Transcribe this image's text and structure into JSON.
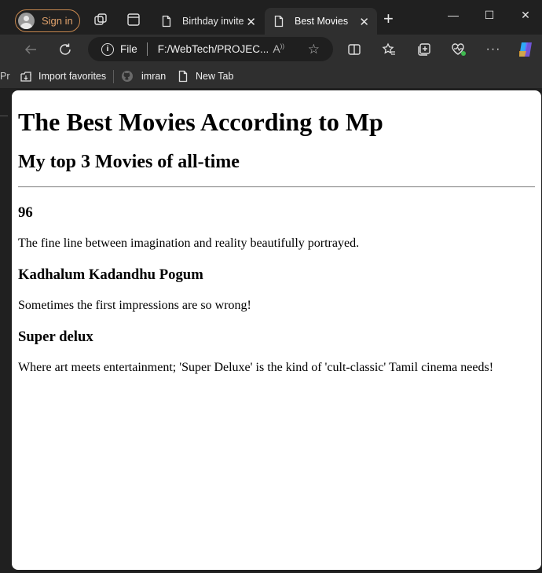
{
  "browser": {
    "signin_label": "Sign in",
    "tabs": [
      {
        "title": "Birthday invite",
        "active": false
      },
      {
        "title": "Best Movies",
        "active": true
      }
    ],
    "new_tab_symbol": "+",
    "window_controls": {
      "minimize": "—",
      "maximize": "☐",
      "close": "✕"
    },
    "address": {
      "scheme": "File",
      "url": "F:/WebTech/PROJEC..."
    },
    "favorites": [
      {
        "label": "Import favorites",
        "icon": "import-favorites-icon"
      },
      {
        "label": "imran",
        "icon": "github-icon"
      },
      {
        "label": "New Tab",
        "icon": "document-icon"
      }
    ],
    "clipped_side_text": "Pr",
    "accent_color": "#c8884f",
    "copilot_colors": [
      "#2ea9f5",
      "#7b5cf5",
      "#f5a623"
    ]
  },
  "page": {
    "heading": "The Best Movies According to Mp",
    "subheading": "My top 3 Movies of all-time",
    "movies": [
      {
        "title": "96",
        "description": "The fine line between imagination and reality beautifully portrayed."
      },
      {
        "title": "Kadhalum Kadandhu Pogum",
        "description": "Sometimes the first impressions are so wrong!"
      },
      {
        "title": "Super delux",
        "description": "Where art meets entertainment; 'Super Deluxe' is the kind of 'cult-classic' Tamil cinema needs!"
      }
    ]
  }
}
